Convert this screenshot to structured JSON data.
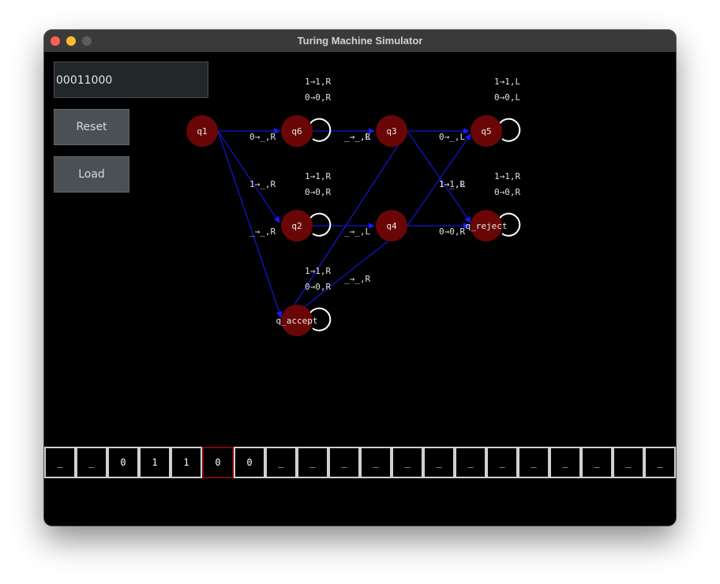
{
  "window": {
    "title": "Turing Machine Simulator"
  },
  "controls": {
    "input_value": "00011000",
    "reset_label": "Reset",
    "load_label": "Load"
  },
  "colors": {
    "state_fill": "#6a0606",
    "edge": "#1a1aff",
    "head_border": "#7a0a0a"
  },
  "states": [
    "q1",
    "q6",
    "q3",
    "q5",
    "q2",
    "q4",
    "q_reject",
    "q_accept"
  ],
  "transitions": [
    {
      "from": "q1",
      "to": "q6",
      "label": "0→_,R"
    },
    {
      "from": "q1",
      "to": "q2",
      "label": "1→_,R"
    },
    {
      "from": "q1",
      "to": "q_accept",
      "label": "_→_,R"
    },
    {
      "from": "q6",
      "to": "q6",
      "labels": [
        "1→1,R",
        "0→0,R"
      ]
    },
    {
      "from": "q6",
      "to": "q3",
      "label": "_→_,L"
    },
    {
      "from": "q2",
      "to": "q2",
      "labels": [
        "1→1,R",
        "0→0,R"
      ]
    },
    {
      "from": "q2",
      "to": "q4",
      "label": "_→_,L"
    },
    {
      "from": "q3",
      "to": "q5",
      "label": "0→_,L"
    },
    {
      "from": "q3",
      "to": "q_reject",
      "label": "1→1,R"
    },
    {
      "from": "q3",
      "to": "q_accept",
      "label": "_→_,R"
    },
    {
      "from": "q4",
      "to": "q5",
      "label": "1→_,L"
    },
    {
      "from": "q4",
      "to": "q_reject",
      "label": "0→0,R"
    },
    {
      "from": "q4",
      "to": "q_accept",
      "label": "_→_,R"
    },
    {
      "from": "q5",
      "to": "q5",
      "labels": [
        "1→1,L",
        "0→0,L"
      ]
    },
    {
      "from": "q_reject",
      "to": "q_reject",
      "labels": [
        "1→1,R",
        "0→0,R"
      ]
    },
    {
      "from": "q_accept",
      "to": "q_accept",
      "labels": [
        "1→1,R",
        "0→0,R"
      ]
    }
  ],
  "tape": {
    "cells": [
      "_",
      "_",
      "0",
      "1",
      "1",
      "0",
      "0",
      "_",
      "_",
      "_",
      "_",
      "_",
      "_",
      "_",
      "_",
      "_",
      "_",
      "_",
      "_",
      "_"
    ],
    "head_index": 5
  }
}
